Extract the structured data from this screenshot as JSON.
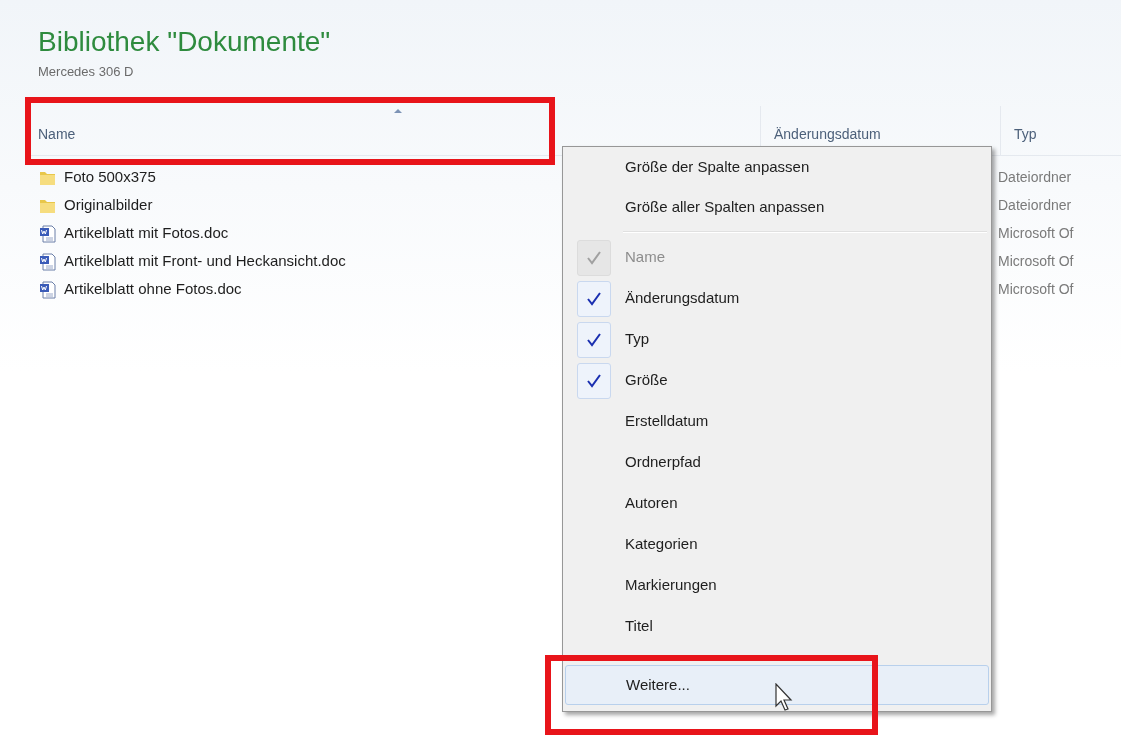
{
  "library": {
    "title": "Bibliothek \"Dokumente\"",
    "subtitle": "Mercedes 306 D"
  },
  "columns": [
    {
      "label": "Name",
      "sorted": true
    },
    {
      "label": "Änderungsdatum",
      "sorted": false
    },
    {
      "label": "Typ",
      "sorted": false
    }
  ],
  "files": [
    {
      "kind": "folder",
      "name": "Foto 500x375",
      "type": "Dateiordner"
    },
    {
      "kind": "folder",
      "name": "Originalbilder",
      "type": "Dateiordner"
    },
    {
      "kind": "doc",
      "name": "Artikelblatt mit Fotos.doc",
      "type": "Microsoft Of"
    },
    {
      "kind": "doc",
      "name": "Artikelblatt mit Front- und Heckansicht.doc",
      "type": "Microsoft Of"
    },
    {
      "kind": "doc",
      "name": "Artikelblatt ohne Fotos.doc",
      "type": "Microsoft Of"
    }
  ],
  "context_menu": {
    "actions": [
      {
        "label": "Größe der Spalte anpassen"
      },
      {
        "label": "Größe aller Spalten anpassen"
      }
    ],
    "columns": [
      {
        "label": "Name",
        "checked": true,
        "disabled": true
      },
      {
        "label": "Änderungsdatum",
        "checked": true,
        "disabled": false
      },
      {
        "label": "Typ",
        "checked": true,
        "disabled": false
      },
      {
        "label": "Größe",
        "checked": true,
        "disabled": false
      },
      {
        "label": "Erstelldatum",
        "checked": false,
        "disabled": false
      },
      {
        "label": "Ordnerpfad",
        "checked": false,
        "disabled": false
      },
      {
        "label": "Autoren",
        "checked": false,
        "disabled": false
      },
      {
        "label": "Kategorien",
        "checked": false,
        "disabled": false
      },
      {
        "label": "Markierungen",
        "checked": false,
        "disabled": false
      },
      {
        "label": "Titel",
        "checked": false,
        "disabled": false
      }
    ],
    "more": {
      "label": "Weitere...",
      "selected": true
    }
  }
}
